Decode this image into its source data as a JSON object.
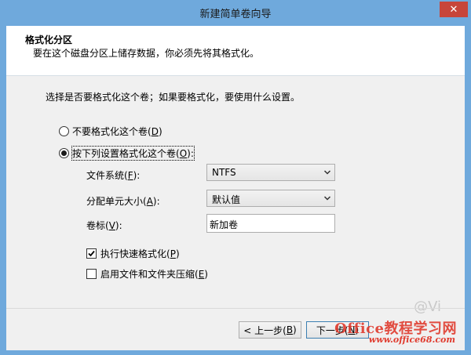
{
  "window": {
    "title": "新建简单卷向导",
    "close_glyph": "✕"
  },
  "header": {
    "title": "格式化分区",
    "subtitle": "要在这个磁盘分区上储存数据，你必须先将其格式化。"
  },
  "prompt": "选择是否要格式化这个卷；如果要格式化，要使用什么设置。",
  "options": {
    "no_format_label": "不要格式化这个卷(",
    "no_format_key": "D",
    "no_format_end": ")",
    "format_label": "按下列设置格式化这个卷(",
    "format_key": "O",
    "format_end": "):",
    "selected": "format"
  },
  "fields": {
    "fs_label": "文件系统(",
    "fs_key": "F",
    "fs_end": "):",
    "fs_value": "NTFS",
    "alloc_label": "分配单元大小(",
    "alloc_key": "A",
    "alloc_end": "):",
    "alloc_value": "默认值",
    "vol_label": "卷标(",
    "vol_key": "V",
    "vol_end": "):",
    "vol_value": "新加卷"
  },
  "checks": {
    "quick_label": "执行快速格式化(",
    "quick_key": "P",
    "quick_end": ")",
    "quick_checked": true,
    "compress_label": "启用文件和文件夹压缩(",
    "compress_key": "E",
    "compress_end": ")",
    "compress_checked": false
  },
  "buttons": {
    "back": "< 上一步(",
    "back_key": "B",
    "back_end": ")",
    "next": "下一步(",
    "next_key": "N",
    "next_end": ")"
  },
  "watermark": {
    "brand": "Office教程学习网",
    "url": "www.office68.com",
    "weibo": "@Vi"
  },
  "colors": {
    "titlebar": "#6fa9dc",
    "close": "#c7453a",
    "panel": "#f0f0f0",
    "watermark": "#e03b2e"
  }
}
